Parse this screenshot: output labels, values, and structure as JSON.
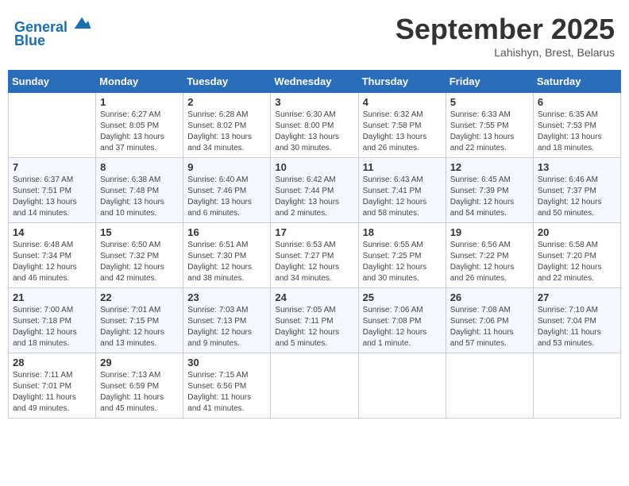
{
  "header": {
    "logo_line1": "General",
    "logo_line2": "Blue",
    "month": "September 2025",
    "location": "Lahishyn, Brest, Belarus"
  },
  "weekdays": [
    "Sunday",
    "Monday",
    "Tuesday",
    "Wednesday",
    "Thursday",
    "Friday",
    "Saturday"
  ],
  "weeks": [
    [
      {
        "day": "",
        "info": ""
      },
      {
        "day": "1",
        "info": "Sunrise: 6:27 AM\nSunset: 8:05 PM\nDaylight: 13 hours\nand 37 minutes."
      },
      {
        "day": "2",
        "info": "Sunrise: 6:28 AM\nSunset: 8:02 PM\nDaylight: 13 hours\nand 34 minutes."
      },
      {
        "day": "3",
        "info": "Sunrise: 6:30 AM\nSunset: 8:00 PM\nDaylight: 13 hours\nand 30 minutes."
      },
      {
        "day": "4",
        "info": "Sunrise: 6:32 AM\nSunset: 7:58 PM\nDaylight: 13 hours\nand 26 minutes."
      },
      {
        "day": "5",
        "info": "Sunrise: 6:33 AM\nSunset: 7:55 PM\nDaylight: 13 hours\nand 22 minutes."
      },
      {
        "day": "6",
        "info": "Sunrise: 6:35 AM\nSunset: 7:53 PM\nDaylight: 13 hours\nand 18 minutes."
      }
    ],
    [
      {
        "day": "7",
        "info": "Sunrise: 6:37 AM\nSunset: 7:51 PM\nDaylight: 13 hours\nand 14 minutes."
      },
      {
        "day": "8",
        "info": "Sunrise: 6:38 AM\nSunset: 7:48 PM\nDaylight: 13 hours\nand 10 minutes."
      },
      {
        "day": "9",
        "info": "Sunrise: 6:40 AM\nSunset: 7:46 PM\nDaylight: 13 hours\nand 6 minutes."
      },
      {
        "day": "10",
        "info": "Sunrise: 6:42 AM\nSunset: 7:44 PM\nDaylight: 13 hours\nand 2 minutes."
      },
      {
        "day": "11",
        "info": "Sunrise: 6:43 AM\nSunset: 7:41 PM\nDaylight: 12 hours\nand 58 minutes."
      },
      {
        "day": "12",
        "info": "Sunrise: 6:45 AM\nSunset: 7:39 PM\nDaylight: 12 hours\nand 54 minutes."
      },
      {
        "day": "13",
        "info": "Sunrise: 6:46 AM\nSunset: 7:37 PM\nDaylight: 12 hours\nand 50 minutes."
      }
    ],
    [
      {
        "day": "14",
        "info": "Sunrise: 6:48 AM\nSunset: 7:34 PM\nDaylight: 12 hours\nand 46 minutes."
      },
      {
        "day": "15",
        "info": "Sunrise: 6:50 AM\nSunset: 7:32 PM\nDaylight: 12 hours\nand 42 minutes."
      },
      {
        "day": "16",
        "info": "Sunrise: 6:51 AM\nSunset: 7:30 PM\nDaylight: 12 hours\nand 38 minutes."
      },
      {
        "day": "17",
        "info": "Sunrise: 6:53 AM\nSunset: 7:27 PM\nDaylight: 12 hours\nand 34 minutes."
      },
      {
        "day": "18",
        "info": "Sunrise: 6:55 AM\nSunset: 7:25 PM\nDaylight: 12 hours\nand 30 minutes."
      },
      {
        "day": "19",
        "info": "Sunrise: 6:56 AM\nSunset: 7:22 PM\nDaylight: 12 hours\nand 26 minutes."
      },
      {
        "day": "20",
        "info": "Sunrise: 6:58 AM\nSunset: 7:20 PM\nDaylight: 12 hours\nand 22 minutes."
      }
    ],
    [
      {
        "day": "21",
        "info": "Sunrise: 7:00 AM\nSunset: 7:18 PM\nDaylight: 12 hours\nand 18 minutes."
      },
      {
        "day": "22",
        "info": "Sunrise: 7:01 AM\nSunset: 7:15 PM\nDaylight: 12 hours\nand 13 minutes."
      },
      {
        "day": "23",
        "info": "Sunrise: 7:03 AM\nSunset: 7:13 PM\nDaylight: 12 hours\nand 9 minutes."
      },
      {
        "day": "24",
        "info": "Sunrise: 7:05 AM\nSunset: 7:11 PM\nDaylight: 12 hours\nand 5 minutes."
      },
      {
        "day": "25",
        "info": "Sunrise: 7:06 AM\nSunset: 7:08 PM\nDaylight: 12 hours\nand 1 minute."
      },
      {
        "day": "26",
        "info": "Sunrise: 7:08 AM\nSunset: 7:06 PM\nDaylight: 11 hours\nand 57 minutes."
      },
      {
        "day": "27",
        "info": "Sunrise: 7:10 AM\nSunset: 7:04 PM\nDaylight: 11 hours\nand 53 minutes."
      }
    ],
    [
      {
        "day": "28",
        "info": "Sunrise: 7:11 AM\nSunset: 7:01 PM\nDaylight: 11 hours\nand 49 minutes."
      },
      {
        "day": "29",
        "info": "Sunrise: 7:13 AM\nSunset: 6:59 PM\nDaylight: 11 hours\nand 45 minutes."
      },
      {
        "day": "30",
        "info": "Sunrise: 7:15 AM\nSunset: 6:56 PM\nDaylight: 11 hours\nand 41 minutes."
      },
      {
        "day": "",
        "info": ""
      },
      {
        "day": "",
        "info": ""
      },
      {
        "day": "",
        "info": ""
      },
      {
        "day": "",
        "info": ""
      }
    ]
  ]
}
